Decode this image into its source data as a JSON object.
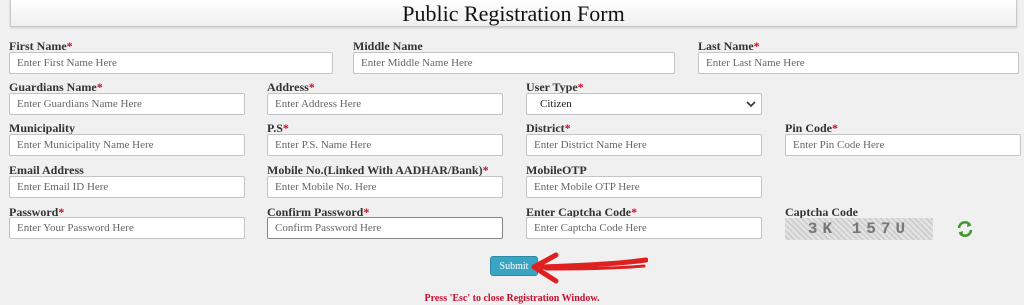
{
  "form": {
    "title": "Public Registration Form",
    "required_mark": "*"
  },
  "fields": {
    "first_name": {
      "label": "First Name",
      "placeholder": "Enter First Name Here",
      "required": true
    },
    "middle_name": {
      "label": "Middle Name",
      "placeholder": "Enter Middle Name Here",
      "required": false
    },
    "last_name": {
      "label": "Last Name",
      "placeholder": "Enter Last Name Here",
      "required": true
    },
    "guardians_name": {
      "label": "Guardians Name",
      "placeholder": "Enter Guardians Name Here",
      "required": true
    },
    "address": {
      "label": "Address",
      "placeholder": "Enter Address Here",
      "required": true
    },
    "user_type": {
      "label": "User Type",
      "value": "Citizen",
      "required": true
    },
    "municipality": {
      "label": "Municipality",
      "placeholder": "Enter Municipality Name Here",
      "required": false
    },
    "ps": {
      "label": "P.S",
      "placeholder": "Enter P.S. Name Here",
      "required": true
    },
    "district": {
      "label": "District",
      "placeholder": "Enter District Name Here",
      "required": true
    },
    "pin_code": {
      "label": "Pin Code",
      "placeholder": "Enter Pin Code Here",
      "required": true
    },
    "email": {
      "label": "Email Address",
      "placeholder": "Enter Email ID Here",
      "required": false
    },
    "mobile": {
      "label": "Mobile No.(Linked With AADHAR/Bank)",
      "placeholder": "Enter Mobile No. Here",
      "required": true
    },
    "mobile_otp": {
      "label": "MobileOTP",
      "placeholder": "Enter Mobile OTP Here",
      "required": false
    },
    "password": {
      "label": "Password",
      "placeholder": "Enter Your Password Here",
      "required": true
    },
    "confirm_password": {
      "label": "Confirm Password",
      "placeholder": "Confirm Password Here",
      "required": true
    },
    "captcha_input": {
      "label": "Enter Captcha Code",
      "placeholder": "Enter Captcha Code Here",
      "required": true
    }
  },
  "captcha": {
    "label": "Captcha Code",
    "code": "3K 157U",
    "refresh_icon": "refresh-icon"
  },
  "actions": {
    "submit_label": "Submit"
  },
  "footer": {
    "note": "Press 'Esc' to close Registration Window."
  },
  "colors": {
    "required": "#c8102e",
    "submit_bg": "#3aa4c3",
    "arrow": "#e02020",
    "refresh": "#3c9a2a"
  }
}
